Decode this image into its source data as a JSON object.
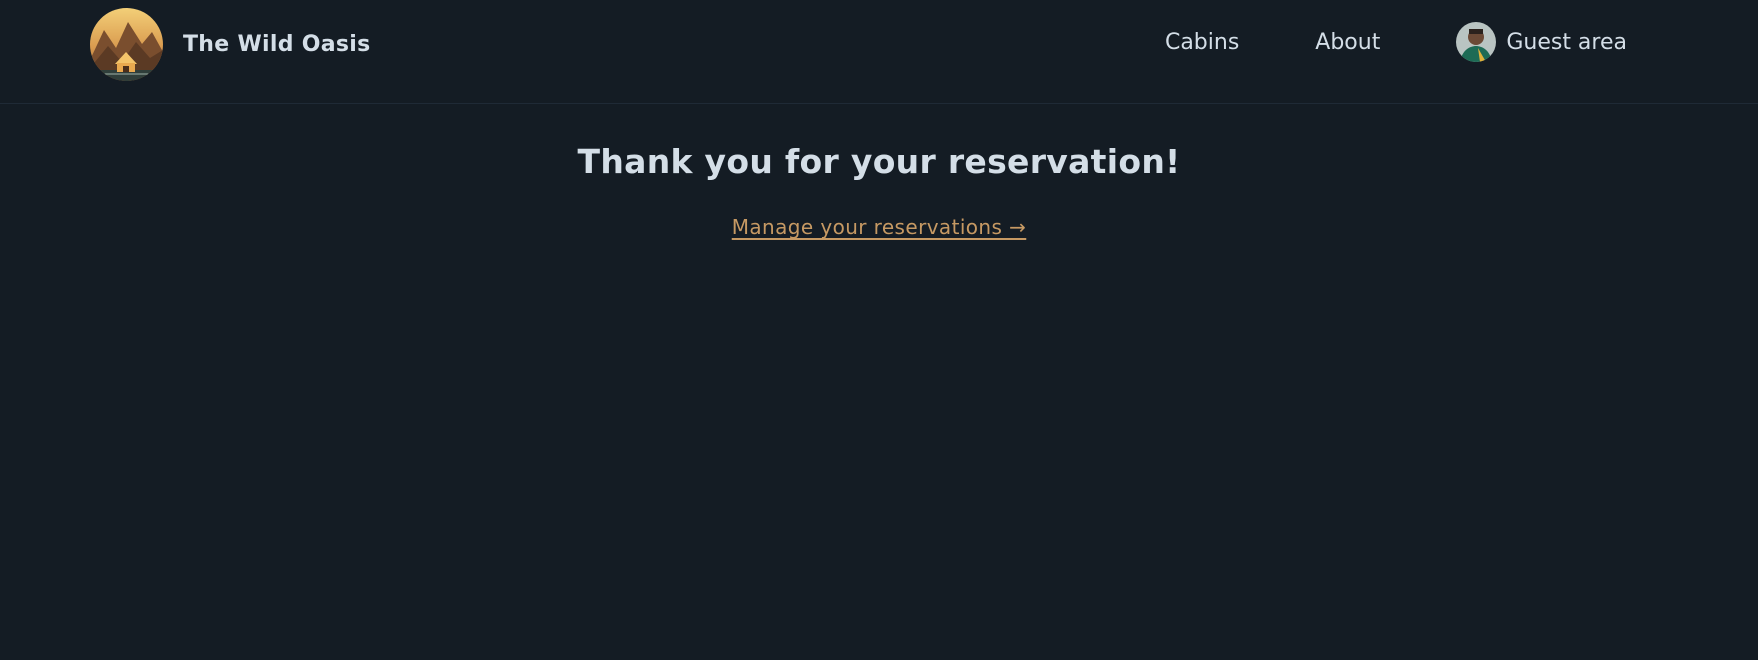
{
  "brand": {
    "name": "The Wild Oasis",
    "logo_icon": "mountain-cabin-logo"
  },
  "nav": {
    "items": [
      {
        "label": "Cabins"
      },
      {
        "label": "About"
      },
      {
        "label": "Guest area",
        "icon": "user-avatar"
      }
    ]
  },
  "main": {
    "heading": "Thank you for your reservation!",
    "link_label": "Manage your reservations →"
  },
  "colors": {
    "background": "#141c24",
    "text": "#d4dee7",
    "accent": "#c69963",
    "divider": "#1f2a36"
  }
}
